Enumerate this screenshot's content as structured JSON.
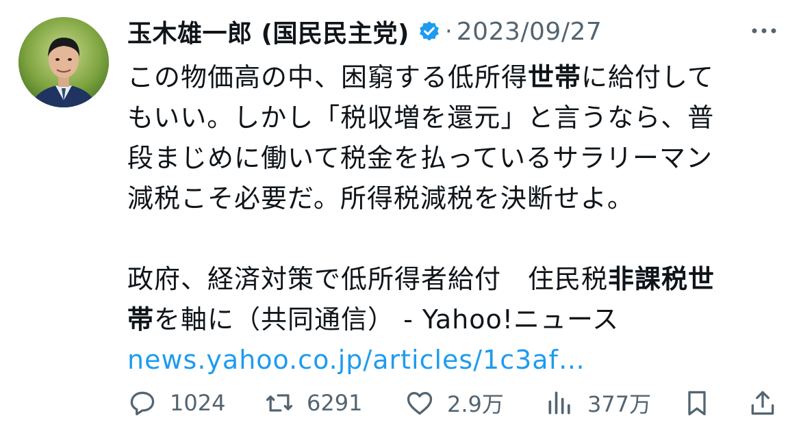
{
  "tweet": {
    "author_name": "玉木雄一郎 (国民民主党)",
    "separator": "·",
    "date": "2023/09/27",
    "text_lines": [
      [
        {
          "t": "この物価高の中、困窮する低所得"
        },
        {
          "t": "世帯",
          "b": true
        },
        {
          "t": "に給付して"
        }
      ],
      [
        {
          "t": "もいい。しかし「税収増を還元」と言うなら、普"
        }
      ],
      [
        {
          "t": "段まじめに働いて税金を払っているサラリーマン"
        }
      ],
      [
        {
          "t": "減税こそ必要だ。所得税減税を決断せよ。"
        }
      ],
      [],
      [
        {
          "t": "政府、経済対策で低所得者給付　住民税"
        },
        {
          "t": "非課税世",
          "b": true
        }
      ],
      [
        {
          "t": "帯",
          "b": true
        },
        {
          "t": "を軸に（共同通信） - Yahoo!ニュース"
        }
      ]
    ],
    "link_text": "news.yahoo.co.jp/articles/1c3af…"
  },
  "actions": {
    "replies": "1024",
    "retweets": "6291",
    "likes": "2.9万",
    "views": "377万"
  },
  "colors": {
    "text": "#0f1419",
    "secondary": "#536471",
    "link": "#1d9bf0",
    "verified": "#1d9bf0"
  },
  "icons": [
    "more-icon",
    "verified-badge-icon",
    "reply-icon",
    "retweet-icon",
    "like-icon",
    "views-icon",
    "bookmark-icon",
    "share-icon"
  ]
}
